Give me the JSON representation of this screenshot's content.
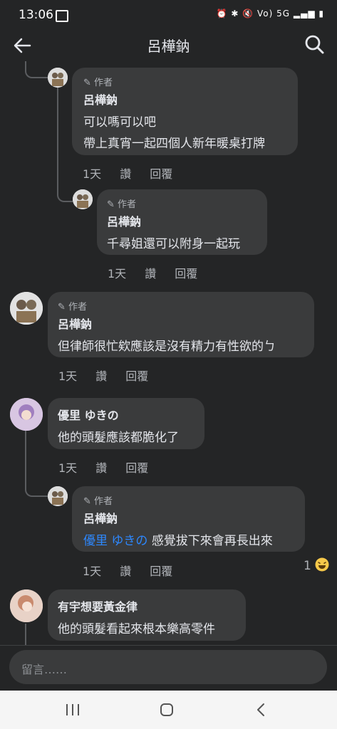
{
  "status": {
    "time": "13:06",
    "indicators": "Vo) 5G"
  },
  "header": {
    "title": "呂樺鈉"
  },
  "comments": [
    {
      "author_tag": "作者",
      "name": "呂樺鈉",
      "lines": [
        "可以嗎可以吧",
        "帶上真宵一起四個人新年暖桌打牌"
      ],
      "time": "1天",
      "like": "讚",
      "reply": "回覆"
    },
    {
      "author_tag": "作者",
      "name": "呂樺鈉",
      "lines": [
        "千尋姐還可以附身一起玩"
      ],
      "time": "1天",
      "like": "讚",
      "reply": "回覆"
    },
    {
      "author_tag": "作者",
      "name": "呂樺鈉",
      "lines": [
        "但律師很忙欸應該是沒有精力有性欲的ㄅ"
      ],
      "time": "1天",
      "like": "讚",
      "reply": "回覆"
    },
    {
      "name": "優里 ゆきの",
      "lines": [
        "他的頭髮應該都脆化了"
      ],
      "time": "1天",
      "like": "讚",
      "reply": "回覆"
    },
    {
      "author_tag": "作者",
      "name": "呂樺鈉",
      "mention": "優里 ゆきの",
      "rest": "感覺拔下來會再長出來",
      "time": "1天",
      "like": "讚",
      "reply": "回覆",
      "reactions": "1"
    },
    {
      "name": "有宇想要黃金律",
      "lines": [
        "他的頭髮看起來根本樂高零件"
      ]
    }
  ],
  "composer": {
    "placeholder": "留言……"
  },
  "icons": {
    "back": "back-arrow-icon",
    "search": "search-icon",
    "edit": "pencil-icon",
    "reaction": "laughing-emoji-icon"
  },
  "colors": {
    "background": "#242526",
    "bubble": "#3a3b3c",
    "mention": "#2d88ff"
  }
}
